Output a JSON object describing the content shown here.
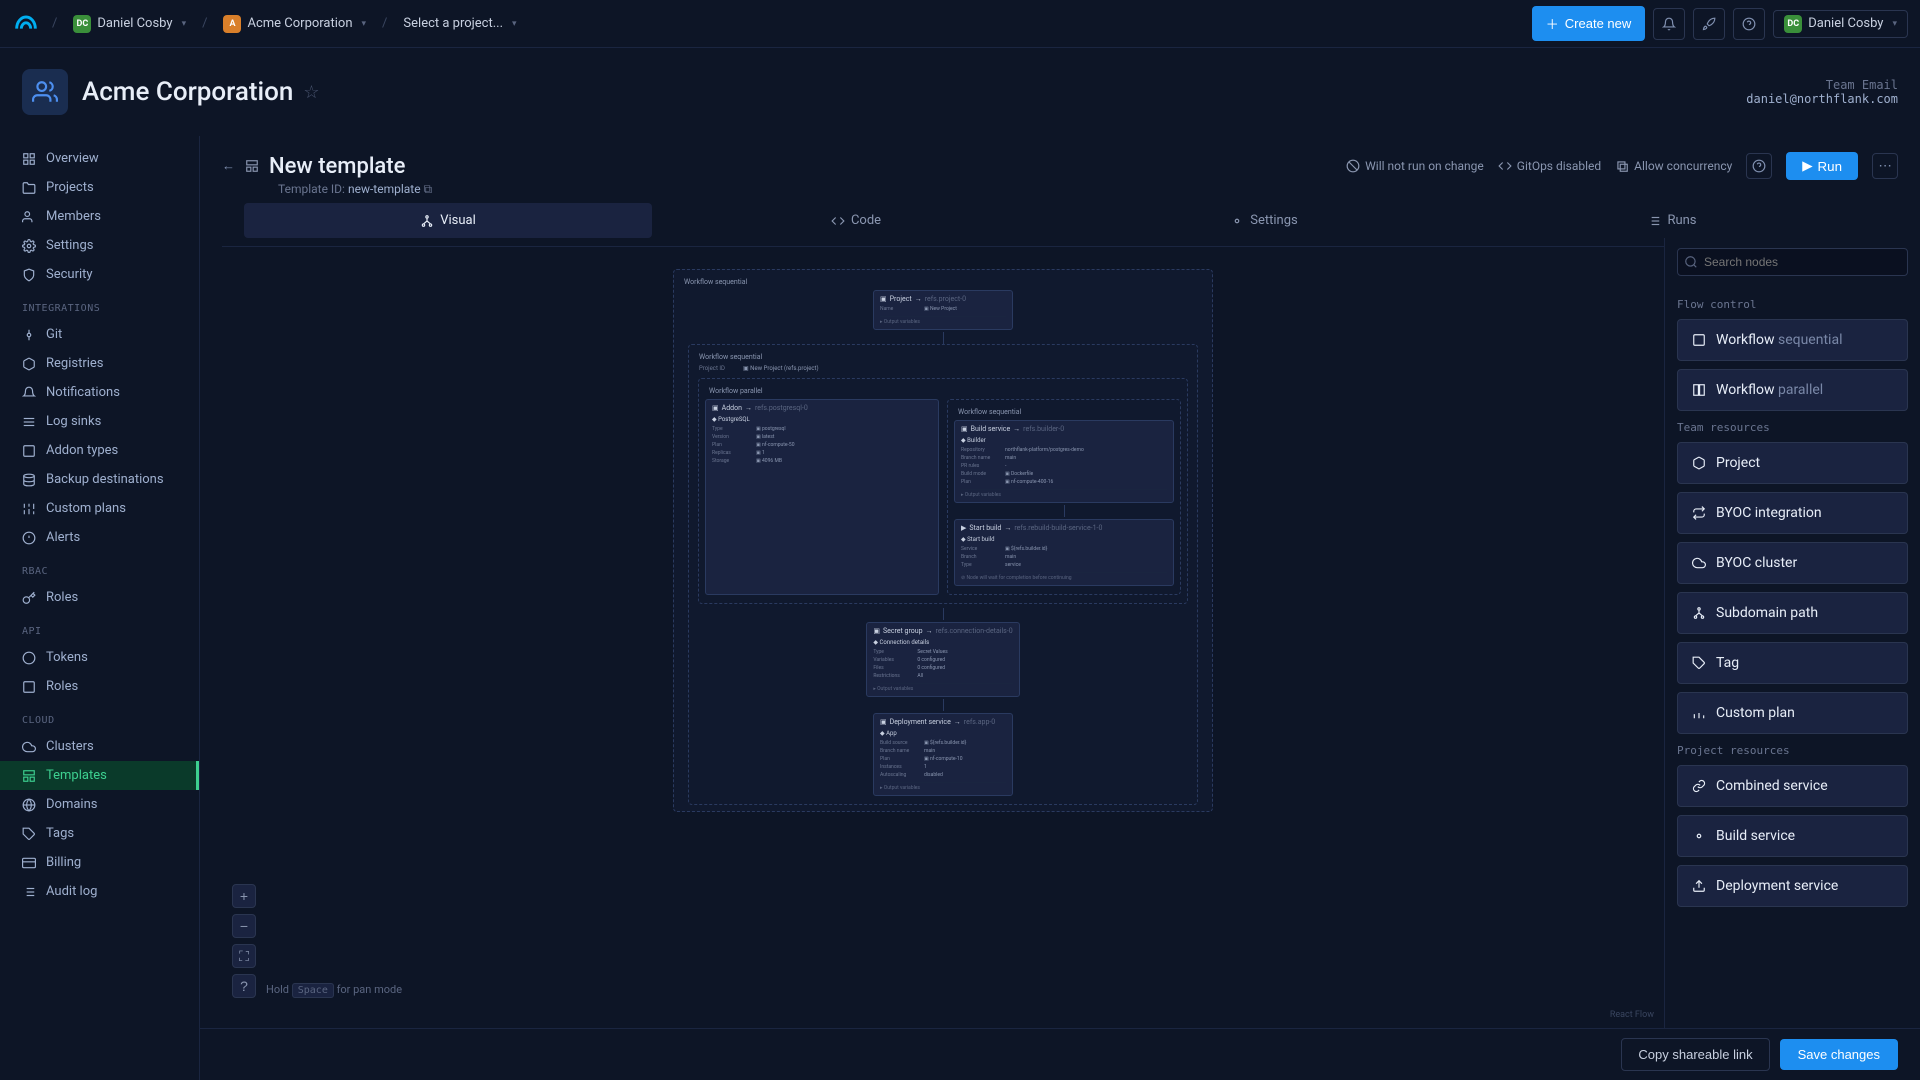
{
  "topbar": {
    "user_crumb": "Daniel Cosby",
    "org_crumb": "Acme Corporation",
    "project_crumb": "Select a project...",
    "create_new": "Create new",
    "user_menu": "Daniel Cosby"
  },
  "org": {
    "name": "Acme Corporation",
    "email_label": "Team Email",
    "email": "daniel@northflank.com"
  },
  "sidebar": {
    "items_main": [
      "Overview",
      "Projects",
      "Members",
      "Settings",
      "Security"
    ],
    "heading_integrations": "INTEGRATIONS",
    "items_integrations": [
      "Git",
      "Registries",
      "Notifications",
      "Log sinks",
      "Addon types",
      "Backup destinations",
      "Custom plans",
      "Alerts"
    ],
    "heading_rbac": "RBAC",
    "items_rbac": [
      "Roles"
    ],
    "heading_api": "API",
    "items_api": [
      "Tokens",
      "Roles"
    ],
    "heading_cloud": "CLOUD",
    "items_cloud": [
      "Clusters",
      "Templates",
      "Domains",
      "Tags",
      "Billing",
      "Audit log"
    ]
  },
  "page": {
    "title": "New template",
    "template_id_label": "Template ID:",
    "template_id": "new-template",
    "status_willnotrun": "Will not run on change",
    "status_gitops": "GitOps disabled",
    "status_concurrency": "Allow concurrency",
    "run_btn": "Run"
  },
  "tabs": {
    "visual": "Visual",
    "code": "Code",
    "settings": "Settings",
    "runs": "Runs"
  },
  "canvas": {
    "pan_hint_hold": "Hold",
    "pan_hint_space": "Space",
    "pan_hint_rest": "for pan mode",
    "attribution": "React Flow",
    "wf_seq": "Workflow sequential",
    "wf_par": "Workflow parallel",
    "node_project_title": "Project",
    "node_project_ref": "refs.project-0",
    "node_project_name_lbl": "Name",
    "node_project_name_val": "New Project",
    "out_vars": "Output variables",
    "projectid_lbl": "Project ID",
    "projectid_val": "New Project (refs.project)",
    "addon_title": "Addon",
    "addon_ref": "refs.postgresql-0",
    "addon_name": "PostgreSQL",
    "addon_type_lbl": "Type",
    "addon_type_val": "postgresql",
    "addon_ver_lbl": "Version",
    "addon_ver_val": "latest",
    "addon_plan_lbl": "Plan",
    "addon_plan_val": "nf-compute-50",
    "addon_rep_lbl": "Replicas",
    "addon_rep_val": "1",
    "addon_storage_lbl": "Storage",
    "addon_storage_val": "4096 MB",
    "build_title": "Build service",
    "build_ref": "refs.builder-0",
    "build_name": "Builder",
    "build_repo_lbl": "Repository",
    "build_repo_val": "northflank-platform/postgres-demo",
    "build_branch_lbl": "Branch name",
    "build_branch_val": "main",
    "build_pr_lbl": "PR rules",
    "build_mode_lbl": "Build mode",
    "build_mode_val": "Dockerfile",
    "build_plan_lbl": "Plan",
    "build_plan_val": "nf-compute-400-16",
    "startbuild_title": "Start build",
    "startbuild_ref": "refs.rebuild-build-service-1-0",
    "startbuild_name": "Start build",
    "startbuild_svc_lbl": "Service",
    "startbuild_svc_val": "${refs.builder.id}",
    "startbuild_branch_lbl": "Branch",
    "startbuild_branch_val": "main",
    "startbuild_type_lbl": "Type",
    "startbuild_type_val": "service",
    "startbuild_wait": "Node will wait for completion before continuing",
    "secret_title": "Secret group",
    "secret_ref": "refs.connection-details-0",
    "secret_name": "Connection details",
    "secret_type_lbl": "Type",
    "secret_type_val": "Secret Values",
    "secret_vars_lbl": "Variables",
    "secret_vars_val": "0 configured",
    "secret_files_lbl": "Files",
    "secret_files_val": "0 configured",
    "secret_restr_lbl": "Restrictions",
    "secret_restr_val": "All",
    "deploy_title": "Deployment service",
    "deploy_ref": "refs.app-0",
    "deploy_name": "App",
    "deploy_src_lbl": "Build source",
    "deploy_src_val": "${refs.builder.id}",
    "deploy_branch_lbl": "Branch name",
    "deploy_branch_val": "main",
    "deploy_plan_lbl": "Plan",
    "deploy_plan_val": "nf-compute-10",
    "deploy_inst_lbl": "Instances",
    "deploy_inst_val": "1",
    "deploy_auto_lbl": "Autoscaling",
    "deploy_auto_val": "disabled"
  },
  "nodes": {
    "search_placeholder": "Search nodes",
    "heading_flow": "Flow control",
    "workflow": "Workflow",
    "sequential": "sequential",
    "parallel": "parallel",
    "heading_team": "Team resources",
    "project": "Project",
    "byoc_int": "BYOC integration",
    "byoc_cluster": "BYOC cluster",
    "subdomain": "Subdomain path",
    "tag": "Tag",
    "custom_plan": "Custom plan",
    "heading_project": "Project resources",
    "combined": "Combined service",
    "build_service": "Build service",
    "deployment": "Deployment service"
  },
  "footer": {
    "copy": "Copy shareable link",
    "save": "Save changes"
  }
}
